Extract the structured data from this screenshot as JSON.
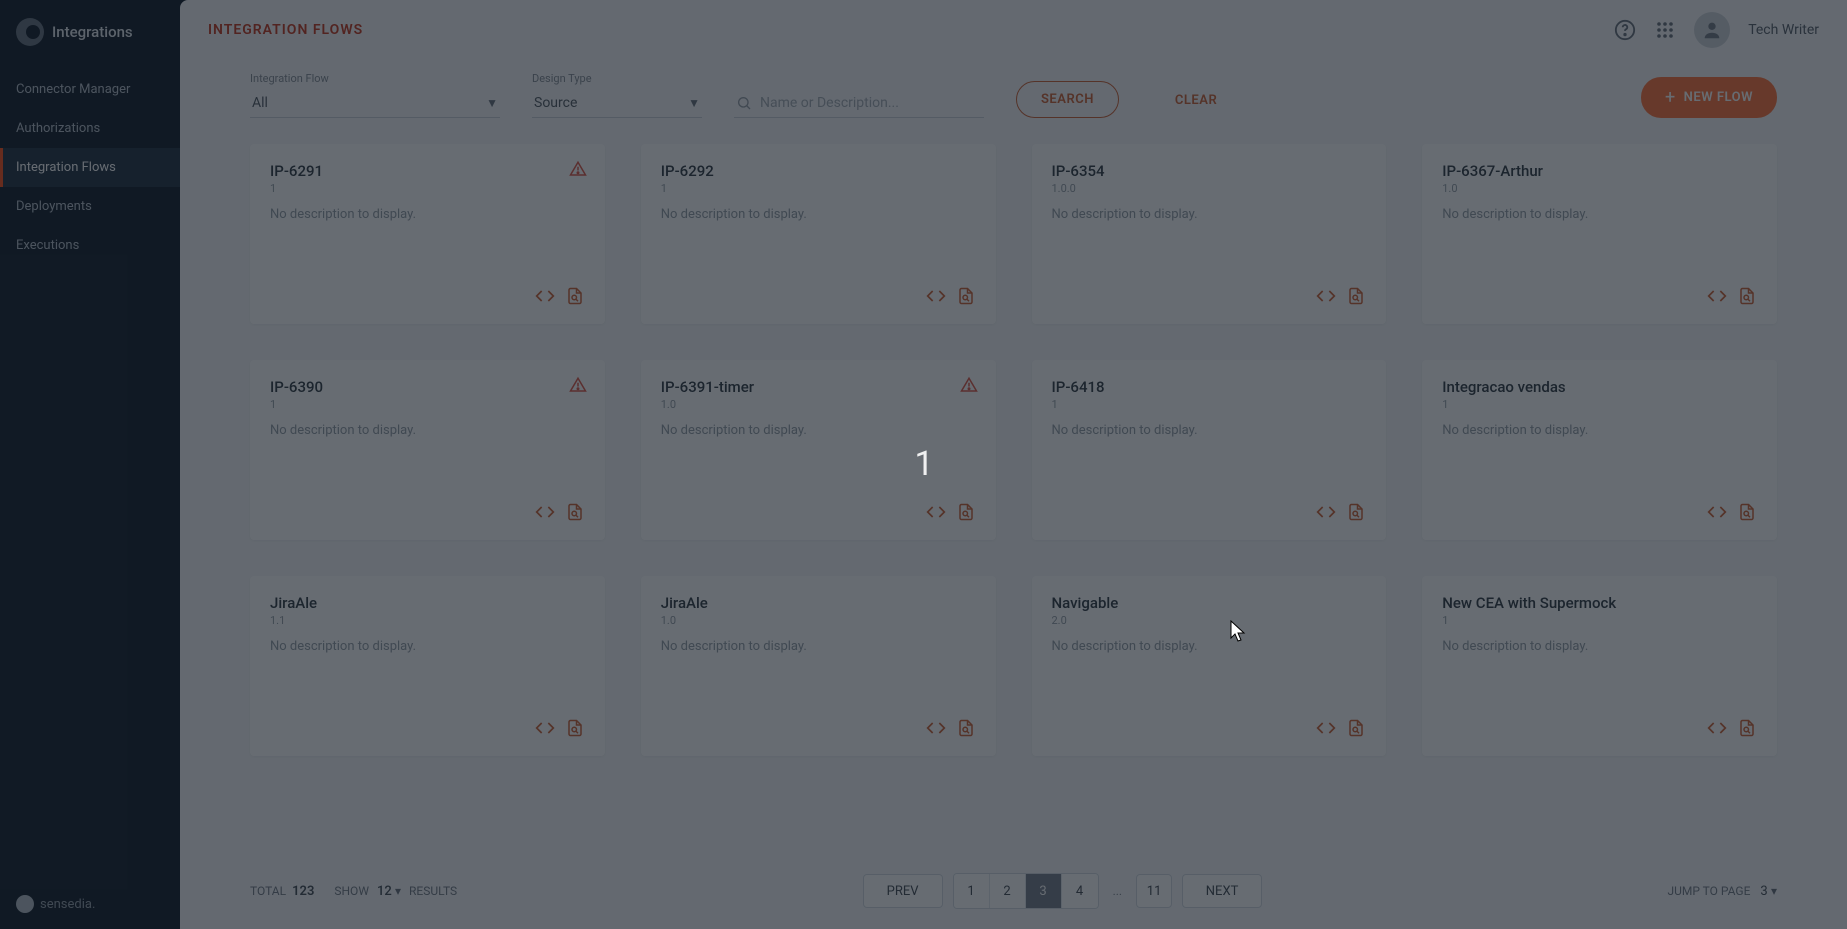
{
  "brand": {
    "name": "Integrations",
    "footer": "sensedia."
  },
  "user": {
    "name": "Tech Writer"
  },
  "nav": {
    "items": [
      {
        "label": "Connector Manager"
      },
      {
        "label": "Authorizations"
      },
      {
        "label": "Integration Flows"
      },
      {
        "label": "Deployments"
      },
      {
        "label": "Executions"
      }
    ]
  },
  "page": {
    "title": "INTEGRATION FLOWS"
  },
  "filters": {
    "flow_label": "Integration Flow",
    "flow_value": "All",
    "type_label": "Design Type",
    "type_value": "Source",
    "search_placeholder": "Name or Description..."
  },
  "buttons": {
    "search": "SEARCH",
    "clear": "CLEAR",
    "new_flow": "NEW FLOW"
  },
  "no_desc": "No description to display.",
  "cards": [
    {
      "title": "IP-6291",
      "ver": "1",
      "warn": true
    },
    {
      "title": "IP-6292",
      "ver": "1",
      "warn": false
    },
    {
      "title": "IP-6354",
      "ver": "1.0.0",
      "warn": false
    },
    {
      "title": "IP-6367-Arthur",
      "ver": "1.0",
      "warn": false
    },
    {
      "title": "IP-6390",
      "ver": "1",
      "warn": true
    },
    {
      "title": "IP-6391-timer",
      "ver": "1.0",
      "warn": true
    },
    {
      "title": "IP-6418",
      "ver": "1",
      "warn": false
    },
    {
      "title": "Integracao vendas",
      "ver": "1",
      "warn": false
    },
    {
      "title": "JiraAle",
      "ver": "1.1",
      "warn": false
    },
    {
      "title": "JiraAle",
      "ver": "1.0",
      "warn": false
    },
    {
      "title": "Navigable",
      "ver": "2.0",
      "warn": false
    },
    {
      "title": "New CEA with Supermock",
      "ver": "1",
      "warn": false
    }
  ],
  "pagination": {
    "total_label": "TOTAL",
    "total": "123",
    "show_label": "SHOW",
    "show_value": "12",
    "results_label": "RESULTS",
    "prev": "PREV",
    "next": "NEXT",
    "pages": [
      "1",
      "2",
      "3",
      "4"
    ],
    "active_index": 2,
    "ellipsis": "...",
    "last": "11",
    "jump_label": "JUMP TO PAGE",
    "jump_value": "3"
  },
  "overlay_number": "1"
}
